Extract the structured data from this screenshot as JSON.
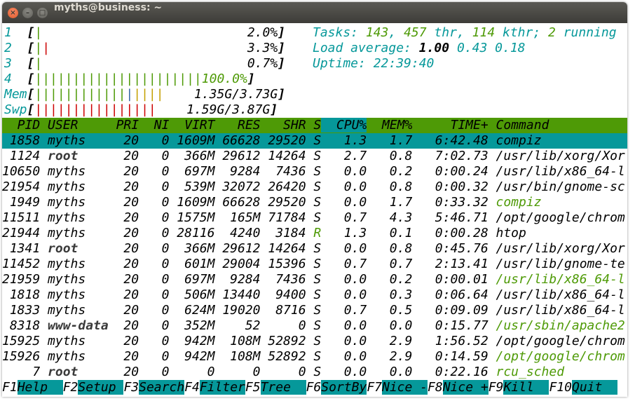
{
  "window": {
    "title": "myths@business: ~"
  },
  "meters": {
    "cpu1": {
      "label": "1",
      "value": "2.0%"
    },
    "cpu2": {
      "label": "2",
      "value": "3.3%"
    },
    "cpu3": {
      "label": "3",
      "value": "0.7%"
    },
    "cpu4": {
      "label": "4",
      "value": "100.0%"
    },
    "mem": {
      "label": "Mem",
      "value": "1.35G/3.73G"
    },
    "swp": {
      "label": "Swp",
      "value": "1.59G/3.87G"
    }
  },
  "summary": {
    "tasks_label": "Tasks:",
    "tasks": "143",
    "thr": "457",
    "thr_label": "thr,",
    "kthr": "114",
    "kthr_label": "kthr;",
    "running": "2",
    "running_label": "running",
    "load_label": "Load average:",
    "load1": "1.00",
    "load5": "0.43",
    "load15": "0.18",
    "uptime_label": "Uptime:",
    "uptime": "22:39:40"
  },
  "columns": [
    "PID",
    "USER",
    "PRI",
    "NI",
    "VIRT",
    "RES",
    "SHR",
    "S",
    "CPU%",
    "MEM%",
    "TIME+",
    "Command"
  ],
  "processes": [
    [
      "1858",
      "myths",
      "20",
      "0",
      "1609M",
      "66628",
      "29520",
      "S",
      "1.3",
      "1.7",
      "6:42.48",
      "compiz"
    ],
    [
      "1124",
      "root",
      "20",
      "0",
      "366M",
      "29612",
      "14264",
      "S",
      "2.7",
      "0.8",
      "7:02.73",
      "/usr/lib/xorg/Xor"
    ],
    [
      "10650",
      "myths",
      "20",
      "0",
      "697M",
      "9284",
      "7436",
      "S",
      "0.0",
      "0.2",
      "0:00.24",
      "/usr/lib/x86_64-l"
    ],
    [
      "21954",
      "myths",
      "20",
      "0",
      "539M",
      "32072",
      "26420",
      "S",
      "0.0",
      "0.8",
      "0:00.32",
      "/usr/bin/gnome-sc"
    ],
    [
      "1949",
      "myths",
      "20",
      "0",
      "1609M",
      "66628",
      "29520",
      "S",
      "0.0",
      "1.7",
      "0:33.32",
      "compiz"
    ],
    [
      "11511",
      "myths",
      "20",
      "0",
      "1575M",
      "165M",
      "71784",
      "S",
      "0.7",
      "4.3",
      "5:46.71",
      "/opt/google/chrom"
    ],
    [
      "21944",
      "myths",
      "20",
      "0",
      "28116",
      "4240",
      "3184",
      "R",
      "1.3",
      "0.1",
      "0:00.28",
      "htop"
    ],
    [
      "1341",
      "root",
      "20",
      "0",
      "366M",
      "29612",
      "14264",
      "S",
      "0.0",
      "0.8",
      "0:45.76",
      "/usr/lib/xorg/Xor"
    ],
    [
      "11452",
      "myths",
      "20",
      "0",
      "601M",
      "29004",
      "15396",
      "S",
      "0.7",
      "0.7",
      "2:13.41",
      "/usr/lib/gnome-te"
    ],
    [
      "21959",
      "myths",
      "20",
      "0",
      "697M",
      "9284",
      "7436",
      "S",
      "0.0",
      "0.2",
      "0:00.01",
      "/usr/lib/x86_64-l"
    ],
    [
      "1818",
      "myths",
      "20",
      "0",
      "506M",
      "13440",
      "9400",
      "S",
      "0.0",
      "0.3",
      "0:06.64",
      "/usr/lib/x86_64-l"
    ],
    [
      "1833",
      "myths",
      "20",
      "0",
      "624M",
      "19020",
      "8716",
      "S",
      "0.7",
      "0.5",
      "0:09.09",
      "/usr/lib/x86_64-l"
    ],
    [
      "8318",
      "www-data",
      "20",
      "0",
      "352M",
      "52",
      "0",
      "S",
      "0.0",
      "0.0",
      "0:15.77",
      "/usr/sbin/apache2"
    ],
    [
      "15925",
      "myths",
      "20",
      "0",
      "942M",
      "108M",
      "52892",
      "S",
      "0.0",
      "2.9",
      "1:56.52",
      "/opt/google/chrom"
    ],
    [
      "15926",
      "myths",
      "20",
      "0",
      "942M",
      "108M",
      "52892",
      "S",
      "0.0",
      "2.9",
      "0:14.59",
      "/opt/google/chrom"
    ],
    [
      "7",
      "root",
      "20",
      "0",
      "0",
      "0",
      "0",
      "S",
      "0.0",
      "0.0",
      "0:22.16",
      "rcu_sched"
    ]
  ],
  "thread_rows": [
    4,
    9,
    12,
    14,
    15
  ],
  "function_keys": [
    {
      "key": "F1",
      "label": "Help  "
    },
    {
      "key": "F2",
      "label": "Setup "
    },
    {
      "key": "F3",
      "label": "Search"
    },
    {
      "key": "F4",
      "label": "Filter"
    },
    {
      "key": "F5",
      "label": "Tree  "
    },
    {
      "key": "F6",
      "label": "SortBy"
    },
    {
      "key": "F7",
      "label": "Nice -"
    },
    {
      "key": "F8",
      "label": "Nice +"
    },
    {
      "key": "F9",
      "label": "Kill  "
    },
    {
      "key": "F10",
      "label": "Quit  "
    }
  ],
  "colors": {
    "cyan": "#06989a",
    "green": "#4e9a06",
    "red": "#cc0000",
    "yellow": "#c4a000",
    "blue": "#3465a4"
  }
}
